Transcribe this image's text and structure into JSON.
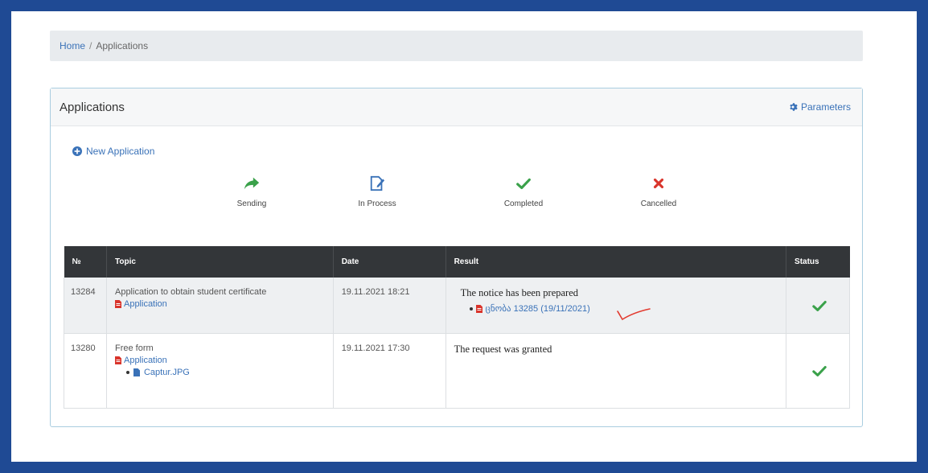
{
  "breadcrumb": {
    "home": "Home",
    "separator": "/",
    "current": "Applications"
  },
  "panel": {
    "title": "Applications",
    "parameters_label": "Parameters"
  },
  "new_application_label": "New Application",
  "legend": [
    {
      "label": "Sending",
      "icon": "share-arrow-icon",
      "color": "#3aa14a"
    },
    {
      "label": "In Process",
      "icon": "edit-document-icon",
      "color": "#3a72b8"
    },
    {
      "label": "Completed",
      "icon": "check-icon",
      "color": "#3aa14a"
    },
    {
      "label": "Cancelled",
      "icon": "cross-icon",
      "color": "#d9342b"
    }
  ],
  "table": {
    "columns": [
      "№",
      "Topic",
      "Date",
      "Result",
      "Status"
    ],
    "rows": [
      {
        "number": "13284",
        "topic": "Application to obtain student certificate",
        "topic_link": "Application",
        "date": "19.11.2021 18:21",
        "result_text": "The notice has been prepared",
        "result_link": "ცნობა 13285 (19/11/2021)",
        "status": "completed"
      },
      {
        "number": "13280",
        "topic": "Free form",
        "topic_link": "Application",
        "attachment": "Captur.JPG",
        "date": "19.11.2021 17:30",
        "result_text": "The request was granted",
        "status": "completed"
      }
    ]
  },
  "colors": {
    "frame": "#1f4a94",
    "link": "#3a72b8",
    "header": "#333639",
    "success": "#3aa14a",
    "danger": "#d9342b",
    "pdf": "#d9342b"
  }
}
